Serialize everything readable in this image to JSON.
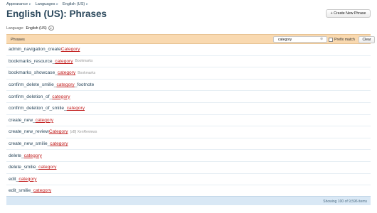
{
  "breadcrumb": [
    {
      "label": "Appearance",
      "sep": "▸"
    },
    {
      "label": "Languages",
      "sep": "▸"
    },
    {
      "label": "English (US)",
      "sep": "▸"
    }
  ],
  "page_title": "English (US): Phrases",
  "create_button": "+ Create New Phrase",
  "language_label": "Language:",
  "language_value": "English (US)",
  "filter": {
    "column_label": "Phrases",
    "search_value": "category",
    "clear_x": "⊗",
    "prefix_label": "Prefix match",
    "clear_button": "Clear"
  },
  "phrases": [
    {
      "pre": "admin_navigation_create",
      "hl": "Category",
      "post": "",
      "meta": ""
    },
    {
      "pre": "bookmarks_resource_",
      "hl": "category",
      "post": "",
      "meta": "Bookmarks"
    },
    {
      "pre": "bookmarks_showcase_",
      "hl": "category",
      "post": "",
      "meta": "Bookmarks"
    },
    {
      "pre": "confirm_delete_smilie_",
      "hl": "category",
      "post": "_footnote",
      "meta": ""
    },
    {
      "pre": "confirm_deletion_of_",
      "hl": "category",
      "post": "",
      "meta": ""
    },
    {
      "pre": "confirm_deletion_of_smilie_",
      "hl": "category",
      "post": "",
      "meta": ""
    },
    {
      "pre": "create_new_",
      "hl": "category",
      "post": "",
      "meta": ""
    },
    {
      "pre": "create_new_review",
      "hl": "Category",
      "post": "",
      "meta": "[xB] XenReviews"
    },
    {
      "pre": "create_new_smilie_",
      "hl": "category",
      "post": "",
      "meta": ""
    },
    {
      "pre": "delete_",
      "hl": "category",
      "post": "",
      "meta": ""
    },
    {
      "pre": "delete_smilie_",
      "hl": "category",
      "post": "",
      "meta": ""
    },
    {
      "pre": "edit_",
      "hl": "category",
      "post": "",
      "meta": ""
    },
    {
      "pre": "edit_smilie_",
      "hl": "category",
      "post": "",
      "meta": ""
    }
  ],
  "footer_text": "Showing 100 of 9,596 items"
}
